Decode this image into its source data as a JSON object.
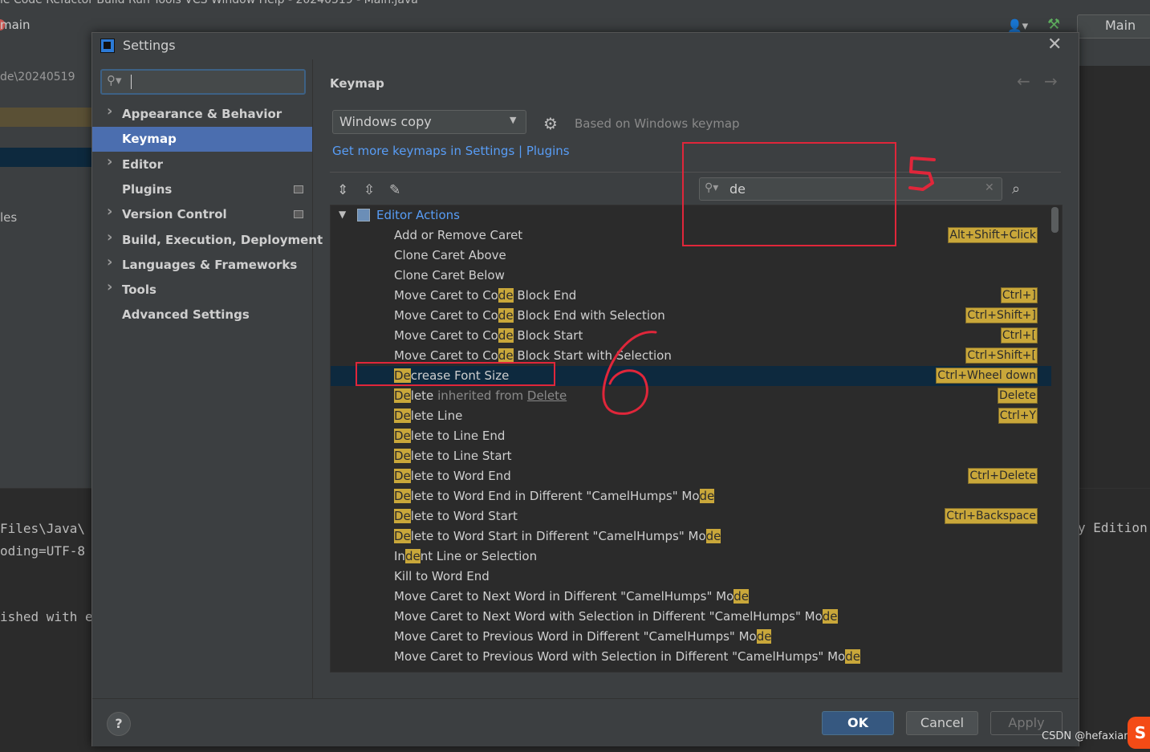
{
  "ide": {
    "menu": "le   Code   Refactor   Build   Run   Tools   VCS   Window   Help   -  20240519 - Main.java",
    "branch": "main",
    "path": "de\\20240519",
    "files_label": "les",
    "main_label": "Main",
    "console_lines": [
      " Files\\Java\\",
      "oding=UTF-8",
      "",
      "ished with e"
    ],
    "edition_text": "y Edition"
  },
  "watermark": "CSDN @hefaxiang",
  "csdn_logo": "S",
  "dialog": {
    "title": "Settings",
    "search": {
      "value": ""
    },
    "sidebar": [
      {
        "label": "Appearance & Behavior",
        "expandable": true,
        "badge": false,
        "selected": false
      },
      {
        "label": "Keymap",
        "expandable": false,
        "badge": false,
        "selected": true
      },
      {
        "label": "Editor",
        "expandable": true,
        "badge": false,
        "selected": false
      },
      {
        "label": "Plugins",
        "expandable": false,
        "badge": true,
        "selected": false
      },
      {
        "label": "Version Control",
        "expandable": true,
        "badge": true,
        "selected": false
      },
      {
        "label": "Build, Execution, Deployment",
        "expandable": true,
        "badge": false,
        "selected": false
      },
      {
        "label": "Languages & Frameworks",
        "expandable": true,
        "badge": false,
        "selected": false
      },
      {
        "label": "Tools",
        "expandable": true,
        "badge": false,
        "selected": false
      },
      {
        "label": "Advanced Settings",
        "expandable": false,
        "badge": false,
        "selected": false
      }
    ],
    "keymap": {
      "title": "Keymap",
      "selected_keymap": "Windows copy",
      "based_on": "Based on Windows keymap",
      "get_more_link": "Get more keymaps in Settings | Plugins",
      "filter_value": "de",
      "category": "Editor Actions",
      "actions": [
        {
          "parts": [
            [
              "Add or Remove Caret",
              ""
            ]
          ],
          "shortcut": "Alt+Shift+Click"
        },
        {
          "parts": [
            [
              "Clone Caret Above",
              ""
            ]
          ],
          "shortcut": ""
        },
        {
          "parts": [
            [
              "Clone Caret Below",
              ""
            ]
          ],
          "shortcut": ""
        },
        {
          "parts": [
            [
              "Move Caret to Co",
              ""
            ],
            [
              "de",
              "hl"
            ],
            [
              " Block End",
              ""
            ]
          ],
          "shortcut": "Ctrl+]"
        },
        {
          "parts": [
            [
              "Move Caret to Co",
              ""
            ],
            [
              "de",
              "hl"
            ],
            [
              " Block End with Selection",
              ""
            ]
          ],
          "shortcut": "Ctrl+Shift+]"
        },
        {
          "parts": [
            [
              "Move Caret to Co",
              ""
            ],
            [
              "de",
              "hl"
            ],
            [
              " Block Start",
              ""
            ]
          ],
          "shortcut": "Ctrl+["
        },
        {
          "parts": [
            [
              "Move Caret to Co",
              ""
            ],
            [
              "de",
              "hl"
            ],
            [
              " Block Start with Selection",
              ""
            ]
          ],
          "shortcut": "Ctrl+Shift+["
        },
        {
          "parts": [
            [
              "De",
              "hl"
            ],
            [
              "crease Font Size",
              ""
            ]
          ],
          "shortcut": "Ctrl+Wheel down",
          "selected": true
        },
        {
          "parts": [
            [
              "De",
              "hl"
            ],
            [
              "lete",
              ""
            ],
            [
              " inherited from ",
              "gray"
            ],
            [
              "Delete",
              "uline"
            ]
          ],
          "shortcut": "Delete"
        },
        {
          "parts": [
            [
              "De",
              "hl"
            ],
            [
              "lete Line",
              ""
            ]
          ],
          "shortcut": "Ctrl+Y"
        },
        {
          "parts": [
            [
              "De",
              "hl"
            ],
            [
              "lete to Line End",
              ""
            ]
          ],
          "shortcut": ""
        },
        {
          "parts": [
            [
              "De",
              "hl"
            ],
            [
              "lete to Line Start",
              ""
            ]
          ],
          "shortcut": ""
        },
        {
          "parts": [
            [
              "De",
              "hl"
            ],
            [
              "lete to Word End",
              ""
            ]
          ],
          "shortcut": "Ctrl+Delete"
        },
        {
          "parts": [
            [
              "De",
              "hl"
            ],
            [
              "lete to Word End in Different \"CamelHumps\" Mo",
              ""
            ],
            [
              "de",
              "hl"
            ]
          ],
          "shortcut": ""
        },
        {
          "parts": [
            [
              "De",
              "hl"
            ],
            [
              "lete to Word Start",
              ""
            ]
          ],
          "shortcut": "Ctrl+Backspace"
        },
        {
          "parts": [
            [
              "De",
              "hl"
            ],
            [
              "lete to Word Start in Different \"CamelHumps\" Mo",
              ""
            ],
            [
              "de",
              "hl"
            ]
          ],
          "shortcut": ""
        },
        {
          "parts": [
            [
              "In",
              ""
            ],
            [
              "de",
              "hl"
            ],
            [
              "nt Line or Selection",
              ""
            ]
          ],
          "shortcut": ""
        },
        {
          "parts": [
            [
              "Kill to Word End",
              ""
            ]
          ],
          "shortcut": ""
        },
        {
          "parts": [
            [
              "Move Caret to Next Word in Different \"CamelHumps\" Mo",
              ""
            ],
            [
              "de",
              "hl"
            ]
          ],
          "shortcut": ""
        },
        {
          "parts": [
            [
              "Move Caret to Next Word with Selection in Different \"CamelHumps\" Mo",
              ""
            ],
            [
              "de",
              "hl"
            ]
          ],
          "shortcut": ""
        },
        {
          "parts": [
            [
              "Move Caret to Previous Word in Different \"CamelHumps\" Mo",
              ""
            ],
            [
              "de",
              "hl"
            ]
          ],
          "shortcut": ""
        },
        {
          "parts": [
            [
              "Move Caret to Previous Word with Selection in Different \"CamelHumps\" Mo",
              ""
            ],
            [
              "de",
              "hl"
            ]
          ],
          "shortcut": ""
        }
      ]
    },
    "buttons": {
      "ok": "OK",
      "cancel": "Cancel",
      "apply": "Apply",
      "help": "?"
    }
  },
  "colors": {
    "accent": "#4b6eaf",
    "highlight": "#c9a73a",
    "annotation": "#e0263a",
    "link": "#589df6"
  }
}
